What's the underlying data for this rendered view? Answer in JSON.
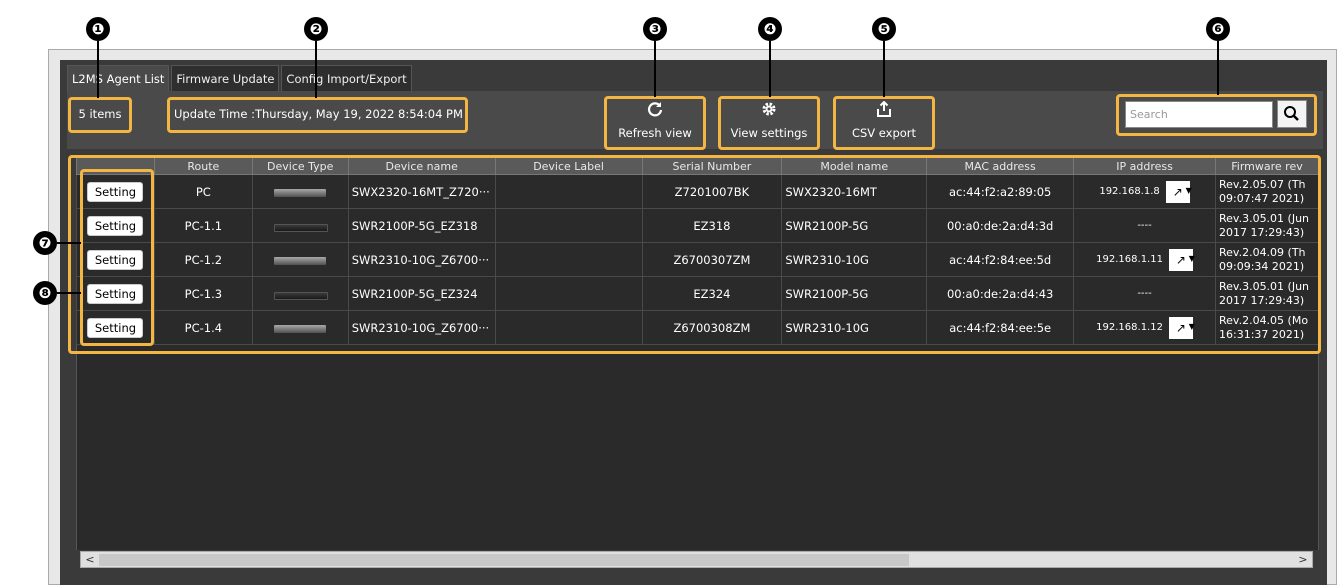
{
  "tabs": [
    "L2MS Agent List",
    "Firmware Update",
    "Config Import/Export"
  ],
  "items_count": "5 items",
  "update_time": "Update Time :Thursday, May 19, 2022 8:54:04 PM",
  "toolbar": {
    "refresh_label": "Refresh view",
    "view_settings_label": "View settings",
    "csv_export_label": "CSV export"
  },
  "search": {
    "placeholder": "Search"
  },
  "table": {
    "columns": [
      "",
      "Route",
      "Device Type",
      "Device name",
      "Device Label",
      "Serial Number",
      "Model name",
      "MAC address",
      "IP address",
      "Firmware rev"
    ],
    "setting_label": "Setting",
    "rows": [
      {
        "route": "PC",
        "device_image": "switch-rack-grey",
        "device_name": "SWX2320-16MT_Z720···",
        "device_label": "",
        "serial": "Z7201007BK",
        "model": "SWX2320-16MT",
        "mac": "ac:44:f2:a2:89:05",
        "ip": "192.168.1.8",
        "fw_line1": "Rev.2.05.07 (Th",
        "fw_line2": "09:07:47 2021)"
      },
      {
        "route": "PC-1.1",
        "device_image": "switch-slim-black",
        "device_name": "SWR2100P-5G_EZ318",
        "device_label": "",
        "serial": "EZ318",
        "model": "SWR2100P-5G",
        "mac": "00:a0:de:2a:d4:3d",
        "ip": "----",
        "fw_line1": "Rev.3.05.01 (Jun",
        "fw_line2": "2017 17:29:43)"
      },
      {
        "route": "PC-1.2",
        "device_image": "switch-rack-grey",
        "device_name": "SWR2310-10G_Z6700···",
        "device_label": "",
        "serial": "Z6700307ZM",
        "model": "SWR2310-10G",
        "mac": "ac:44:f2:84:ee:5d",
        "ip": "192.168.1.11",
        "fw_line1": "Rev.2.04.09 (Th",
        "fw_line2": "09:09:34 2021)"
      },
      {
        "route": "PC-1.3",
        "device_image": "switch-slim-black",
        "device_name": "SWR2100P-5G_EZ324",
        "device_label": "",
        "serial": "EZ324",
        "model": "SWR2100P-5G",
        "mac": "00:a0:de:2a:d4:43",
        "ip": "----",
        "fw_line1": "Rev.3.05.01 (Jun",
        "fw_line2": "2017 17:29:43)"
      },
      {
        "route": "PC-1.4",
        "device_image": "switch-rack-grey",
        "device_name": "SWR2310-10G_Z6700···",
        "device_label": "",
        "serial": "Z6700308ZM",
        "model": "SWR2310-10G",
        "mac": "ac:44:f2:84:ee:5e",
        "ip": "192.168.1.12",
        "fw_line1": "Rev.2.04.05 (Mo",
        "fw_line2": "16:31:37 2021)"
      }
    ]
  },
  "callouts": [
    "❶",
    "❷",
    "❸",
    "❹",
    "❺",
    "❻",
    "❼",
    "❽"
  ],
  "icons": {
    "refresh": "refresh-icon",
    "settings": "gear-icon",
    "export": "export-icon",
    "search": "search-icon",
    "open_link": "external-link-icon"
  },
  "colors": {
    "highlight": "#f4b642",
    "panel": "#3a3a3a",
    "grid_row": "#2a2a2a"
  }
}
